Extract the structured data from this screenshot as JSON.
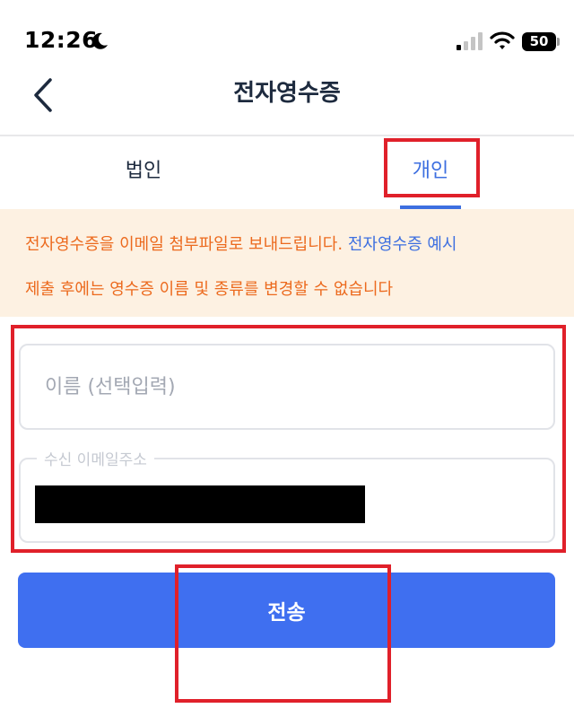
{
  "status_bar": {
    "time": "12:26",
    "battery": "50",
    "icons": [
      "moon-icon",
      "signal-icon",
      "wifi-icon",
      "battery-icon"
    ]
  },
  "nav": {
    "title": "전자영수증",
    "back_icon": "chevron-left-icon"
  },
  "tabs": [
    {
      "label": "법인",
      "active": false
    },
    {
      "label": "개인",
      "active": true
    }
  ],
  "notice": {
    "line1_text": "전자영수증을 이메일 첨부파일로 보내드립니다.",
    "line1_link": "전자영수증 예시",
    "line2": "제출 후에는 영수증 이름 및 종류를 변경할 수 없습니다"
  },
  "form": {
    "name_placeholder": "이름 (선택입력)",
    "name_value": "",
    "email_label": "수신 이메일주소"
  },
  "submit_label": "전송",
  "colors": {
    "accent": "#3d6fe0",
    "button": "#3f6ff0",
    "notice_bg": "#fdf1e2",
    "notice_text": "#ec6a1e",
    "highlight": "#e0202a"
  }
}
